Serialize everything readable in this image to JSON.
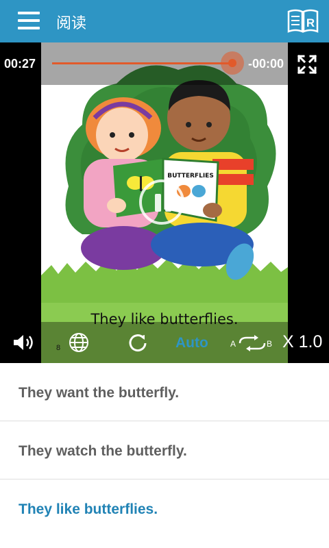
{
  "app_bar": {
    "title": "阅读",
    "menu_icon": "hamburger-menu-icon",
    "book_icon": "book-reader-icon",
    "book_icon_letter": "R"
  },
  "player": {
    "elapsed": "00:27",
    "remaining": "-00:00",
    "progress": 1.0,
    "page_caption": "They like butterflies.",
    "page_number": "8",
    "book_title": "BUTTERFLIES",
    "controls": {
      "auto_label": "Auto",
      "speed_label": "X 1.0",
      "ab_repeat_a": "A",
      "ab_repeat_b": "B"
    },
    "colors": {
      "accent": "#2e95c4",
      "seek": "#e25a2a"
    }
  },
  "sentences": [
    {
      "text": "They want the butterfly.",
      "active": false
    },
    {
      "text": "They watch the butterfly.",
      "active": false
    },
    {
      "text": "They like butterflies.",
      "active": true
    }
  ]
}
